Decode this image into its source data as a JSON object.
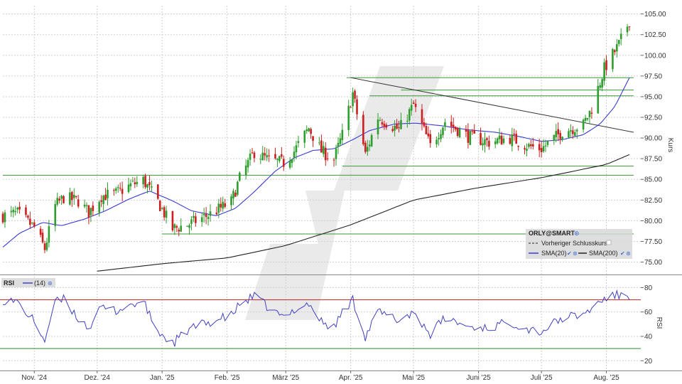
{
  "colors": {
    "up": "#2e9e2e",
    "down": "#cc1f1f",
    "sma20": "#3a3ad6",
    "sma200": "#222222",
    "hline": "#3a9a3a",
    "trend": "#333333",
    "rsi": "#4040c0",
    "rsi_upper": "#c02020",
    "rsi_lower": "#2a8a2a",
    "grid": "#d0d0d0",
    "watermark": "#e6e6e6"
  },
  "chart_data": [
    {
      "type": "candlestick",
      "ylabel": "Kurs",
      "ylim": [
        73.5,
        106
      ],
      "yticks": [
        "75.00",
        "77.50",
        "80.00",
        "82.50",
        "85.00",
        "87.50",
        "90.00",
        "92.50",
        "95.00",
        "97.50",
        "100.00",
        "102.50",
        "105.00"
      ],
      "x_months": [
        "Nov. '24",
        "Dez. '24",
        "Jan. '25",
        "Feb. '25",
        "März '25",
        "Apr. '25",
        "Mai '25",
        "Juni '25",
        "Juli '25",
        "Aug. '25"
      ],
      "date_range": [
        "2024-10-17",
        "2025-08-12"
      ],
      "price_anchors": [
        [
          "2024-10-17",
          80.6
        ],
        [
          "2024-10-24",
          80.9
        ],
        [
          "2024-11-01",
          79.2
        ],
        [
          "2024-11-06",
          76.6
        ],
        [
          "2024-11-11",
          81.8
        ],
        [
          "2024-11-15",
          82.8
        ],
        [
          "2024-11-22",
          82.4
        ],
        [
          "2024-11-27",
          81.0
        ],
        [
          "2024-12-03",
          83.0
        ],
        [
          "2024-12-10",
          83.3
        ],
        [
          "2024-12-17",
          84.3
        ],
        [
          "2024-12-23",
          84.9
        ],
        [
          "2024-12-30",
          82.3
        ],
        [
          "2025-01-06",
          79.0
        ],
        [
          "2025-01-14",
          79.6
        ],
        [
          "2025-01-24",
          80.8
        ],
        [
          "2025-02-03",
          82.3
        ],
        [
          "2025-02-07",
          85.1
        ],
        [
          "2025-02-14",
          88.3
        ],
        [
          "2025-02-21",
          87.3
        ],
        [
          "2025-02-28",
          87.0
        ],
        [
          "2025-03-05",
          88.4
        ],
        [
          "2025-03-12",
          91.2
        ],
        [
          "2025-03-18",
          88.4
        ],
        [
          "2025-03-24",
          87.4
        ],
        [
          "2025-03-28",
          90.4
        ],
        [
          "2025-04-02",
          95.4
        ],
        [
          "2025-04-08",
          88.0
        ],
        [
          "2025-04-14",
          92.5
        ],
        [
          "2025-04-24",
          91.0
        ],
        [
          "2025-05-01",
          94.0
        ],
        [
          "2025-05-09",
          89.0
        ],
        [
          "2025-05-16",
          92.0
        ],
        [
          "2025-05-27",
          90.2
        ],
        [
          "2025-06-06",
          89.5
        ],
        [
          "2025-06-16",
          90.0
        ],
        [
          "2025-06-25",
          89.0
        ],
        [
          "2025-07-01",
          88.7
        ],
        [
          "2025-07-11",
          90.8
        ],
        [
          "2025-07-21",
          91.6
        ],
        [
          "2025-07-25",
          93.6
        ],
        [
          "2025-07-31",
          98.4
        ],
        [
          "2025-08-07",
          101.3
        ],
        [
          "2025-08-12",
          104.2
        ]
      ],
      "sma20": [
        [
          "2024-10-17",
          76.8
        ],
        [
          "2024-10-25",
          78.5
        ],
        [
          "2024-11-05",
          79.8
        ],
        [
          "2024-11-14",
          79.4
        ],
        [
          "2024-11-25",
          80.2
        ],
        [
          "2024-12-05",
          81.2
        ],
        [
          "2024-12-16",
          82.6
        ],
        [
          "2024-12-26",
          83.6
        ],
        [
          "2025-01-06",
          82.4
        ],
        [
          "2025-01-15",
          81.2
        ],
        [
          "2025-01-27",
          80.6
        ],
        [
          "2025-02-05",
          81.5
        ],
        [
          "2025-02-14",
          83.5
        ],
        [
          "2025-02-24",
          86.0
        ],
        [
          "2025-03-05",
          87.6
        ],
        [
          "2025-03-14",
          88.5
        ],
        [
          "2025-03-24",
          88.7
        ],
        [
          "2025-04-02",
          89.8
        ],
        [
          "2025-04-10",
          90.9
        ],
        [
          "2025-04-22",
          91.7
        ],
        [
          "2025-05-02",
          91.8
        ],
        [
          "2025-05-14",
          91.5
        ],
        [
          "2025-05-27",
          91.0
        ],
        [
          "2025-06-09",
          90.7
        ],
        [
          "2025-06-20",
          90.2
        ],
        [
          "2025-07-01",
          89.6
        ],
        [
          "2025-07-11",
          89.8
        ],
        [
          "2025-07-21",
          90.4
        ],
        [
          "2025-07-29",
          91.7
        ],
        [
          "2025-08-05",
          93.8
        ],
        [
          "2025-08-12",
          97.3
        ]
      ],
      "sma200": [
        [
          "2024-12-01",
          73.9
        ],
        [
          "2025-01-01",
          74.8
        ],
        [
          "2025-02-01",
          75.5
        ],
        [
          "2025-03-01",
          77.0
        ],
        [
          "2025-04-01",
          79.5
        ],
        [
          "2025-05-01",
          82.5
        ],
        [
          "2025-06-01",
          84.0
        ],
        [
          "2025-07-01",
          85.2
        ],
        [
          "2025-08-01",
          86.8
        ],
        [
          "2025-08-12",
          88.0
        ]
      ],
      "trendline": [
        [
          "2025-04-01",
          97.3
        ],
        [
          "2025-08-14",
          90.7
        ]
      ],
      "horizontal_lines": [
        {
          "value": 97.3,
          "from": "2025-03-30",
          "to": "2025-08-14"
        },
        {
          "value": 95.8,
          "from": "2025-04-25",
          "to": "2025-08-14"
        },
        {
          "value": 95.1,
          "from": "2025-04-10",
          "to": "2025-08-14"
        },
        {
          "value": 86.6,
          "from": "2025-03-28",
          "to": "2025-08-14"
        },
        {
          "value": 85.5,
          "from": "2024-10-17",
          "to": "2025-08-14"
        },
        {
          "value": 78.4,
          "from": "2025-01-01",
          "to": "2025-08-14"
        }
      ],
      "legend": {
        "title": "ORLY@SMART",
        "items": [
          {
            "label": "Vorheriger Schlusskurs",
            "style": "dashed"
          },
          {
            "label": "SMA(20)",
            "color": "#3a3ad6"
          },
          {
            "label": "SMA(200)",
            "color": "#222222"
          }
        ]
      }
    },
    {
      "type": "line",
      "ylabel": "RSI",
      "ylim": [
        12,
        89
      ],
      "yticks": [
        "20",
        "40",
        "60",
        "80"
      ],
      "legend_title": "RSI",
      "legend_series": "(14)",
      "upper": 70,
      "lower": 30,
      "values": [
        [
          "2024-10-17",
          70
        ],
        [
          "2024-10-24",
          68
        ],
        [
          "2024-11-01",
          52
        ],
        [
          "2024-11-06",
          37
        ],
        [
          "2024-11-11",
          68
        ],
        [
          "2024-11-15",
          70
        ],
        [
          "2024-11-22",
          55
        ],
        [
          "2024-11-27",
          47
        ],
        [
          "2024-12-03",
          63
        ],
        [
          "2024-12-10",
          61
        ],
        [
          "2024-12-17",
          66
        ],
        [
          "2024-12-23",
          68
        ],
        [
          "2024-12-30",
          44
        ],
        [
          "2025-01-06",
          34
        ],
        [
          "2025-01-14",
          46
        ],
        [
          "2025-01-24",
          52
        ],
        [
          "2025-02-03",
          57
        ],
        [
          "2025-02-07",
          66
        ],
        [
          "2025-02-14",
          73
        ],
        [
          "2025-02-21",
          63
        ],
        [
          "2025-02-28",
          55
        ],
        [
          "2025-03-05",
          62
        ],
        [
          "2025-03-12",
          67
        ],
        [
          "2025-03-18",
          52
        ],
        [
          "2025-03-24",
          47
        ],
        [
          "2025-03-28",
          60
        ],
        [
          "2025-04-02",
          70
        ],
        [
          "2025-04-08",
          40
        ],
        [
          "2025-04-14",
          60
        ],
        [
          "2025-04-24",
          53
        ],
        [
          "2025-05-01",
          60
        ],
        [
          "2025-05-09",
          42
        ],
        [
          "2025-05-16",
          55
        ],
        [
          "2025-05-27",
          48
        ],
        [
          "2025-06-06",
          47
        ],
        [
          "2025-06-16",
          52
        ],
        [
          "2025-06-25",
          46
        ],
        [
          "2025-07-01",
          44
        ],
        [
          "2025-07-11",
          55
        ],
        [
          "2025-07-21",
          58
        ],
        [
          "2025-07-25",
          63
        ],
        [
          "2025-07-31",
          71
        ],
        [
          "2025-08-07",
          74
        ],
        [
          "2025-08-12",
          72
        ]
      ]
    }
  ]
}
